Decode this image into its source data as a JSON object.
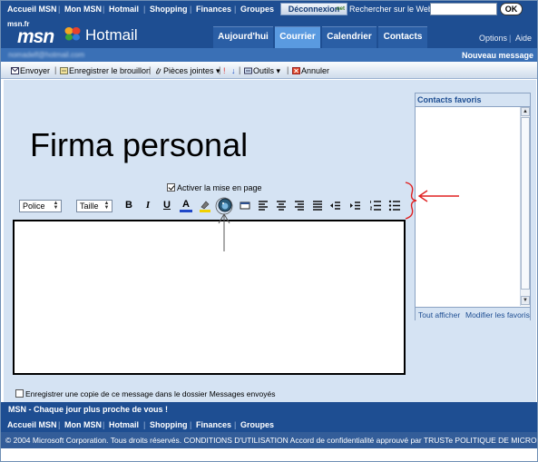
{
  "top_nav": {
    "links": [
      "Accueil MSN",
      "Mon MSN",
      "Hotmail",
      "Shopping",
      "Finances",
      "Groupes"
    ],
    "disconnect_label": "Déconnexion",
    "disconnect_badge": ".net",
    "search_label": "Rechercher sur le Web :",
    "search_value": "",
    "ok_label": "OK"
  },
  "header": {
    "site": "msn.fr",
    "logo": "msn",
    "product": "Hotmail",
    "tabs": [
      {
        "label": "Aujourd'hui",
        "active": false
      },
      {
        "label": "Courrier",
        "active": true
      },
      {
        "label": "Calendrier",
        "active": false
      },
      {
        "label": "Contacts",
        "active": false
      }
    ],
    "options_label": "Options",
    "help_label": "Aide"
  },
  "user_bar": {
    "email": "nomadelf@hotmail.com",
    "new_message_label": "Nouveau message"
  },
  "toolbar": {
    "send": "Envoyer",
    "save_draft": "Enregistrer le brouillon",
    "attachments": "Pièces jointes",
    "tools": "Outils",
    "cancel": "Annuler"
  },
  "compose": {
    "overlay_title": "Firma personal",
    "rich_text_label": "Activer la mise en page",
    "rich_text_checked": true,
    "font_select": "Police",
    "size_select": "Taille",
    "format_buttons": {
      "bold": "B",
      "italic": "I",
      "underline": "U",
      "font_color": "A"
    },
    "body_text": "",
    "save_copy_label": "Enregistrer une copie de ce message dans le dossier Messages envoyés",
    "save_copy_checked": false
  },
  "contacts": {
    "title": "Contacts favoris",
    "show_all": "Tout afficher",
    "edit_favorites": "Modifier les favoris"
  },
  "footer": {
    "tagline": "MSN - Chaque jour plus proche de vous !",
    "links": [
      "Accueil MSN",
      "Mon MSN",
      "Hotmail",
      "Shopping",
      "Finances",
      "Groupes"
    ],
    "copyright": "© 2004 Microsoft Corporation. Tous droits réservés. CONDITIONS D'UTILISATION  Accord de confidentialité approuvé par TRUSTe  POLITIQUE DE MICROSOFT EN"
  },
  "colors": {
    "nav_blue": "#1e4e92",
    "active_tab": "#5a9ae0",
    "panel_bg": "#d5e3f3",
    "annotation_red": "#e02020"
  }
}
